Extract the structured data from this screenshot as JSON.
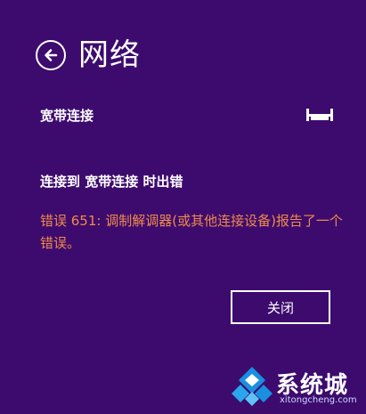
{
  "header": {
    "title": "网络",
    "back_icon": "arrow-left-circle-icon"
  },
  "connection": {
    "name": "宽带连接",
    "icon": "broadband-ethernet-icon"
  },
  "error": {
    "heading": "连接到 宽带连接 时出错",
    "message": "错误 651: 调制解调器(或其他连接设备)报告了一个错误。",
    "color": "#f08a4a"
  },
  "actions": {
    "close_label": "关闭"
  },
  "watermark": {
    "brand": "系统城",
    "url": "xitongcheng.com"
  },
  "colors": {
    "background": "#3d0b6e",
    "text": "#ffffff"
  }
}
